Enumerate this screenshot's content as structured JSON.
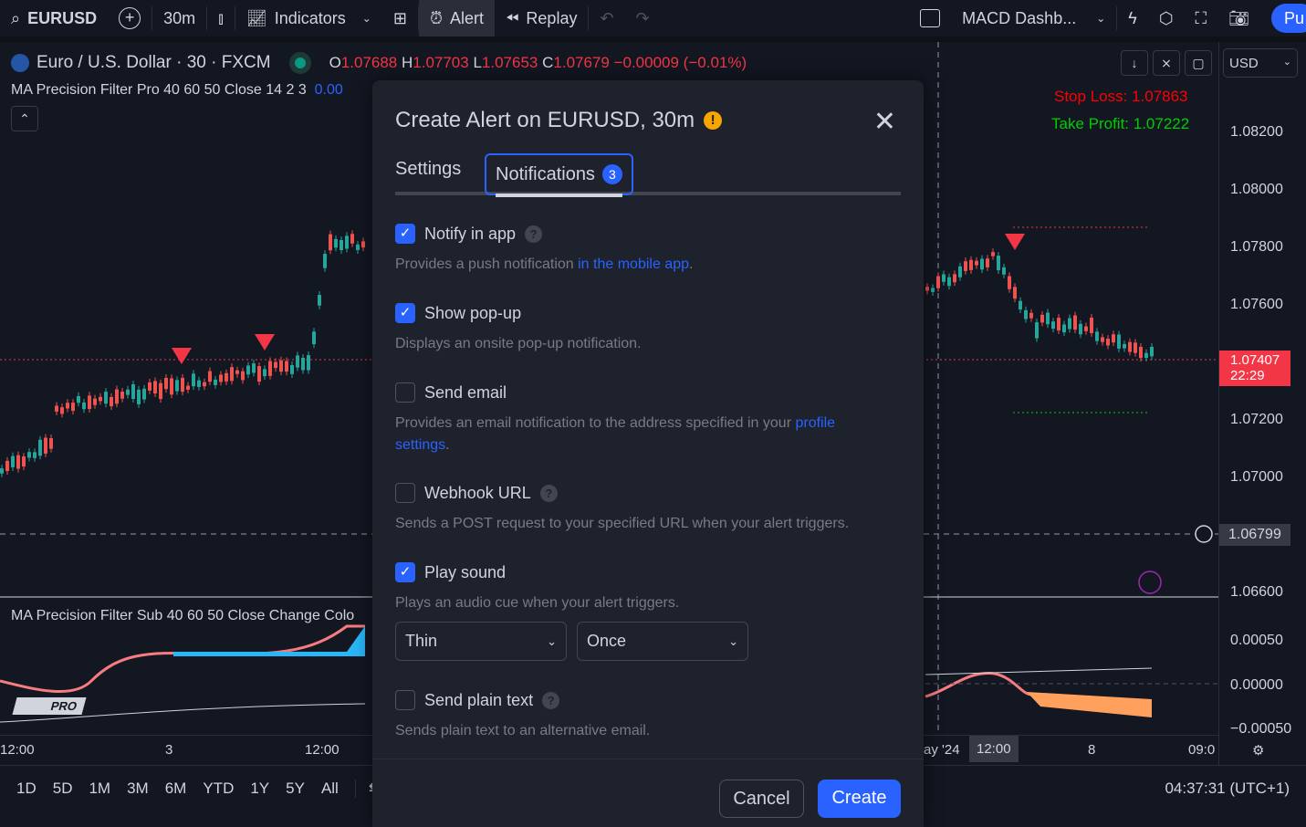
{
  "toolbar": {
    "symbol": "EURUSD",
    "interval": "30m",
    "indicators": "Indicators",
    "alert": "Alert",
    "replay": "Replay",
    "layout": "MACD Dashb...",
    "publish": "Pu"
  },
  "legend": {
    "title": "Euro / U.S. Dollar · 30 · FXCM",
    "o_label": "O",
    "o": "1.07688",
    "h_label": "H",
    "h": "1.07703",
    "l_label": "L",
    "l": "1.07653",
    "c_label": "C",
    "c": "1.07679",
    "change": "−0.00009 (−0.01%)",
    "indicator": "MA Precision Filter Pro 40 60 50 Close 14 2 3",
    "indicator_value": "0.00",
    "sub_indicator": "MA Precision Filter Sub 40 60 50 Close Change Colo"
  },
  "annotations": {
    "stop_loss": "Stop Loss: 1.07863",
    "take_profit": "Take Profit: 1.07222"
  },
  "price_axis": {
    "currency": "USD",
    "ticks": [
      "1.08200",
      "1.08000",
      "1.07800",
      "1.07600",
      "1.07200",
      "1.07000",
      "1.06600",
      "0.00050",
      "0.00000",
      "−0.00050"
    ],
    "current_price": "1.07407",
    "countdown": "22:29",
    "crosshair_price": "1.06799"
  },
  "time_axis": {
    "labels": [
      "12:00",
      "3",
      "12:00",
      "ay '24",
      "12:00",
      "8",
      "09:0"
    ]
  },
  "bottom": {
    "ranges": [
      "1D",
      "5D",
      "1M",
      "3M",
      "6M",
      "YTD",
      "1Y",
      "5Y",
      "All"
    ],
    "clock": "04:37:31 (UTC+1)"
  },
  "logo": "PRO",
  "dialog": {
    "title": "Create Alert on EURUSD, 30m",
    "tabs": {
      "settings": "Settings",
      "notifications": "Notifications",
      "badge": "3"
    },
    "options": [
      {
        "label": "Notify in app",
        "checked": true,
        "desc": "Provides a push notification ",
        "link": "in the mobile app",
        "desc_end": "."
      },
      {
        "label": "Show pop-up",
        "checked": true,
        "desc": "Displays an onsite pop-up notification."
      },
      {
        "label": "Send email",
        "checked": false,
        "desc": "Provides an email notification to the address specified in your ",
        "link": "profile settings",
        "desc_end": "."
      },
      {
        "label": "Webhook URL",
        "checked": false,
        "desc": "Sends a POST request to your specified URL when your alert triggers."
      },
      {
        "label": "Play sound",
        "checked": true,
        "desc": "Plays an audio cue when your alert triggers."
      },
      {
        "label": "Send plain text",
        "checked": false,
        "desc": "Sends plain text to an alternative email."
      }
    ],
    "sound": "Thin",
    "repeat": "Once",
    "cancel": "Cancel",
    "create": "Create"
  },
  "colors": {
    "up": "#26a69a",
    "down": "#ef5350",
    "accent": "#2962ff"
  }
}
